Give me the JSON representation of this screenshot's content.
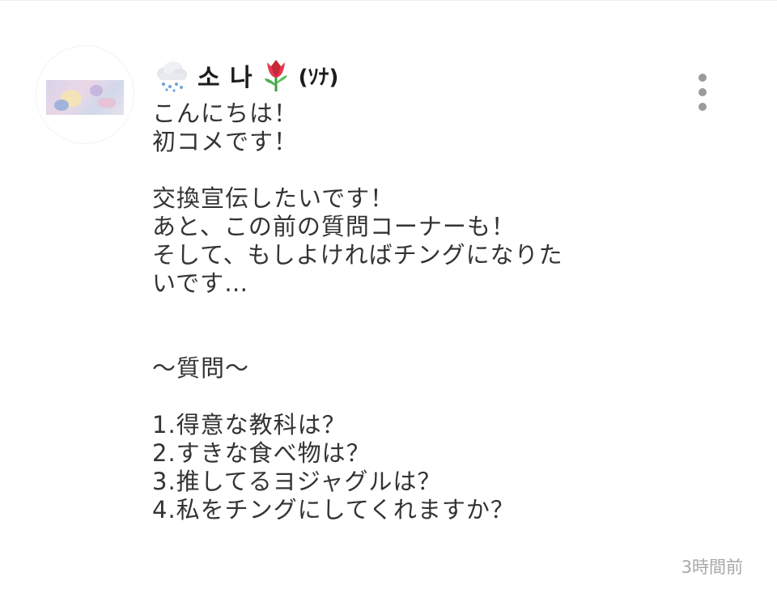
{
  "comment": {
    "author": {
      "name": "소 나",
      "suffix": "(ｿﾅ)",
      "icons": [
        "cloud-snow-icon",
        "tulip-icon"
      ]
    },
    "lines": [
      "こんにちは！",
      "初コメです！",
      "",
      "交換宣伝したいです！",
      "あと、この前の質問コーナーも！",
      "そして、もしよければチングになりた",
      "いです…",
      "",
      "",
      "〜質問〜",
      "",
      "1.得意な教科は？",
      "2.すきな食べ物は？",
      "3.推してるヨジャグルは？",
      "4.私をチングにしてくれますか？"
    ],
    "timestamp": "3時間前",
    "menu_icon": "more-vertical-icon"
  },
  "colors": {
    "text": "#333333",
    "timestamp": "#a8a8a8",
    "menu_dots": "#9b9b9b"
  }
}
